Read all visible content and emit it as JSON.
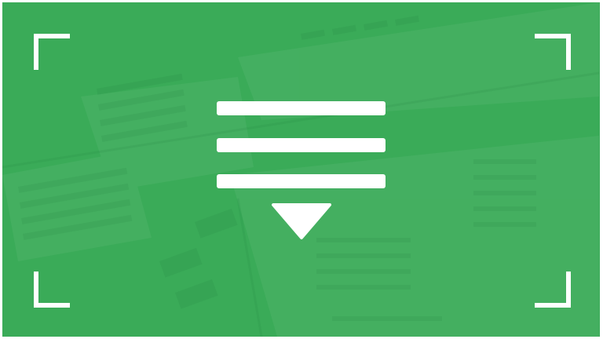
{
  "slide": {
    "background_color": "#3aab58",
    "foreground_color": "#ffffff",
    "icon": "sort-descending-icon",
    "corner_marks": [
      "top-left-corner",
      "top-right-corner",
      "bottom-left-corner",
      "bottom-right-corner"
    ]
  }
}
